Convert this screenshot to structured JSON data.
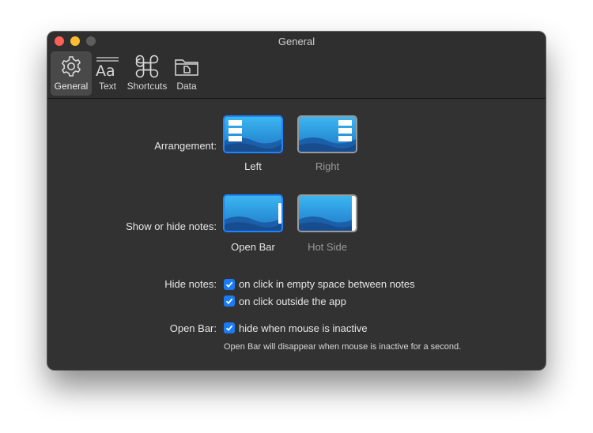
{
  "window": {
    "title": "General"
  },
  "toolbar": {
    "items": [
      {
        "label": "General",
        "icon": "gear-icon",
        "active": true
      },
      {
        "label": "Text",
        "icon": "text-aa-icon"
      },
      {
        "label": "Shortcuts",
        "icon": "command-icon"
      },
      {
        "label": "Data",
        "icon": "folder-icon"
      }
    ]
  },
  "arrangement": {
    "label": "Arrangement:",
    "options": [
      {
        "label": "Left",
        "selected": true
      },
      {
        "label": "Right",
        "selected": false
      }
    ]
  },
  "show_hide": {
    "label": "Show or hide notes:",
    "options": [
      {
        "label": "Open Bar",
        "selected": true
      },
      {
        "label": "Hot Side",
        "selected": false
      }
    ]
  },
  "hide_notes": {
    "label": "Hide notes:",
    "options": [
      {
        "label": "on click in empty space between notes",
        "checked": true
      },
      {
        "label": "on click outside the app",
        "checked": true
      }
    ]
  },
  "open_bar": {
    "label": "Open Bar:",
    "option": {
      "label": "hide when mouse is inactive",
      "checked": true
    },
    "hint": "Open Bar will disappear when mouse is inactive for a second."
  },
  "colors": {
    "accent": "#1a7cf5",
    "window_bg": "#323232"
  }
}
